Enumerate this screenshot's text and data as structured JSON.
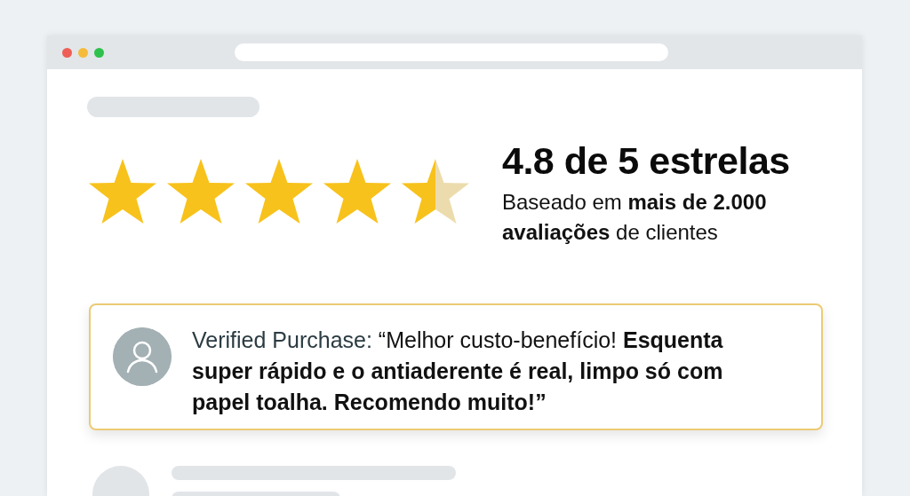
{
  "rating": {
    "stars": 4.5,
    "title": "4.8 de 5 estrelas",
    "summary": "Baseado em **mais de 2.000 avaliações** de clientes"
  },
  "review": {
    "label": "Verified Purchase:",
    "text": "“Melhor custo-benefício! **Esquenta super rápido e o antiaderente é real, limpo só com papel toalha. Recomendo muito!”**"
  }
}
